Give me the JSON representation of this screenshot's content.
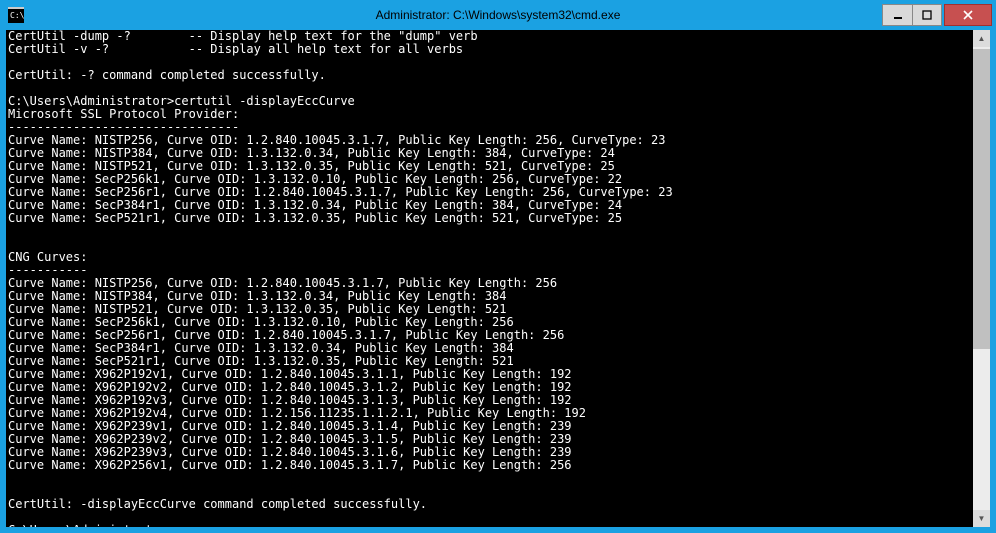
{
  "window": {
    "title": "Administrator: C:\\Windows\\system32\\cmd.exe"
  },
  "help": {
    "dump": "CertUtil -dump -?        -- Display help text for the \"dump\" verb",
    "verbose": "CertUtil -v -?           -- Display all help text for all verbs"
  },
  "completed1": "CertUtil: -? command completed successfully.",
  "prompt": "C:\\Users\\Administrator>",
  "command": "certutil -displayEccCurve",
  "provider_header": "Microsoft SSL Protocol Provider:",
  "provider_sep": "--------------------------------",
  "ssl_curves": [
    "Curve Name: NISTP256, Curve OID: 1.2.840.10045.3.1.7, Public Key Length: 256, CurveType: 23",
    "Curve Name: NISTP384, Curve OID: 1.3.132.0.34, Public Key Length: 384, CurveType: 24",
    "Curve Name: NISTP521, Curve OID: 1.3.132.0.35, Public Key Length: 521, CurveType: 25",
    "Curve Name: SecP256k1, Curve OID: 1.3.132.0.10, Public Key Length: 256, CurveType: 22",
    "Curve Name: SecP256r1, Curve OID: 1.2.840.10045.3.1.7, Public Key Length: 256, CurveType: 23",
    "Curve Name: SecP384r1, Curve OID: 1.3.132.0.34, Public Key Length: 384, CurveType: 24",
    "Curve Name: SecP521r1, Curve OID: 1.3.132.0.35, Public Key Length: 521, CurveType: 25"
  ],
  "cng_header": "CNG Curves:",
  "cng_sep": "-----------",
  "cng_curves": [
    "Curve Name: NISTP256, Curve OID: 1.2.840.10045.3.1.7, Public Key Length: 256",
    "Curve Name: NISTP384, Curve OID: 1.3.132.0.34, Public Key Length: 384",
    "Curve Name: NISTP521, Curve OID: 1.3.132.0.35, Public Key Length: 521",
    "Curve Name: SecP256k1, Curve OID: 1.3.132.0.10, Public Key Length: 256",
    "Curve Name: SecP256r1, Curve OID: 1.2.840.10045.3.1.7, Public Key Length: 256",
    "Curve Name: SecP384r1, Curve OID: 1.3.132.0.34, Public Key Length: 384",
    "Curve Name: SecP521r1, Curve OID: 1.3.132.0.35, Public Key Length: 521",
    "Curve Name: X962P192v1, Curve OID: 1.2.840.10045.3.1.1, Public Key Length: 192",
    "Curve Name: X962P192v2, Curve OID: 1.2.840.10045.3.1.2, Public Key Length: 192",
    "Curve Name: X962P192v3, Curve OID: 1.2.840.10045.3.1.3, Public Key Length: 192",
    "Curve Name: X962P192v4, Curve OID: 1.2.156.11235.1.1.2.1, Public Key Length: 192",
    "Curve Name: X962P239v1, Curve OID: 1.2.840.10045.3.1.4, Public Key Length: 239",
    "Curve Name: X962P239v2, Curve OID: 1.2.840.10045.3.1.5, Public Key Length: 239",
    "Curve Name: X962P239v3, Curve OID: 1.2.840.10045.3.1.6, Public Key Length: 239",
    "Curve Name: X962P256v1, Curve OID: 1.2.840.10045.3.1.7, Public Key Length: 256"
  ],
  "completed2": "CertUtil: -displayEccCurve command completed successfully.",
  "prompt2": "C:\\Users\\Administrator>"
}
